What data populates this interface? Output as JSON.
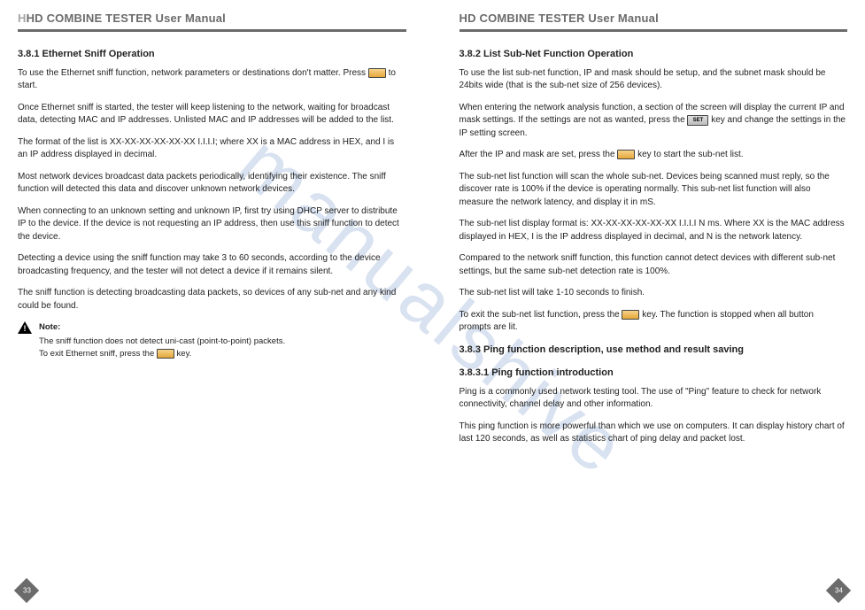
{
  "watermark": "manualshive",
  "left": {
    "header": "HD COMBINE TESTER User Manual",
    "h381": "3.8.1 Ethernet Sniff Operation",
    "p1a": "To use the Ethernet sniff function, network parameters or destinations don't matter. Press ",
    "p1b": " to start.",
    "p2": "Once Ethernet sniff is started, the tester will keep listening to the network, waiting for broadcast data, detecting MAC and IP addresses. Unlisted MAC and IP addresses will be added to the list.",
    "p3": "The format of the list is XX-XX-XX-XX-XX-XX I.I.I.I; where XX is a MAC address in HEX, and I is an IP address displayed in decimal.",
    "p4": "Most network devices broadcast data packets periodically, identifying their existence. The sniff function will detected this data and discover unknown network devices.",
    "p5": "When connecting to an unknown setting and unknown IP, first try using DHCP server to distribute IP to the device. If the device is not requesting an IP address, then use this sniff function to detect the device.",
    "p6": "Detecting a device using the sniff function may take 3 to 60 seconds, according to the device broadcasting frequency, and the tester will not detect a device if it remains silent.",
    "p7": "The sniff function is detecting broadcasting data packets, so devices of any sub-net and any kind could be found.",
    "noteLabel": "Note:",
    "note1": "The sniff function does not detect uni-cast (point-to-point) packets.",
    "note2a": "To exit Ethernet sniff, press the ",
    "note2b": " key.",
    "pageNum": "33"
  },
  "right": {
    "header": "HD COMBINE TESTER User Manual",
    "h382": "3.8.2 List Sub-Net Function Operation",
    "p1": "To use the list sub-net function, IP and mask should be setup, and the subnet mask should be 24bits wide (that is the sub-net size of 256 devices).",
    "p2a": "When entering the network analysis function, a section of the screen will display the current IP and mask settings. If the settings are not as wanted, press the ",
    "p2b": " key and change the settings in the IP setting screen.",
    "setLabel": "SET",
    "p3a": "After the IP and mask are set, press the ",
    "p3b": " key to start the sub-net list.",
    "p4": "The sub-net list function will scan the whole sub-net. Devices being scanned must reply, so the discover rate is 100% if the device is operating normally. This sub-net list function will also measure the network latency, and display it in mS.",
    "p5": "The sub-net list display format is: XX-XX-XX-XX-XX-XX I.I.I.I N ms. Where XX is the MAC address displayed in HEX, I is the IP address displayed in decimal, and N is the network latency.",
    "p6": "Compared to the network sniff function, this function cannot detect devices with different sub-net settings, but the same sub-net detection rate is 100%.",
    "p7": "The sub-net list will take 1-10 seconds to finish.",
    "p8a": "To exit the sub-net list function, press the ",
    "p8b": " key. The function is stopped when all button prompts are lit.",
    "h383": "3.8.3 Ping function description, use method and result saving",
    "h3831": "3.8.3.1 Ping function introduction",
    "p9": "Ping is a commonly used network testing tool. The use of \"Ping\" feature to check for network connectivity, channel delay and other information.",
    "p10": "This ping function is more powerful than which we use on computers. It can display history chart of last 120 seconds, as well as statistics chart of ping delay and packet lost.",
    "pageNum": "34"
  }
}
